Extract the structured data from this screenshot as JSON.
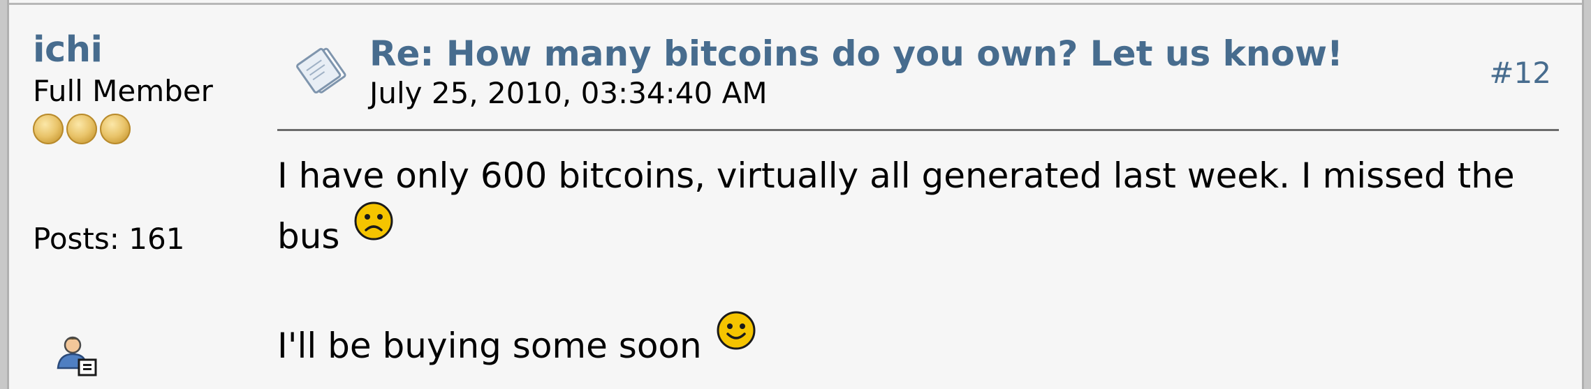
{
  "poster": {
    "name": "ichi",
    "rank": "Full Member",
    "posts": "Posts: 161",
    "stars": 3
  },
  "post": {
    "title": "Re: How many bitcoins do you own? Let us know!",
    "date": "July 25, 2010, 03:34:40 AM",
    "number": "#12",
    "paragraphs": [
      {
        "text": "I have only 600 bitcoins, virtually all generated last week.  I missed the bus",
        "smiley": "sad-smiley-icon"
      },
      {
        "text": "I'll be buying some soon",
        "smiley": "smiley-icon"
      }
    ]
  },
  "colors": {
    "link": "#476c8e",
    "background": "#f6f6f6",
    "separator": "#6b6b6b"
  }
}
